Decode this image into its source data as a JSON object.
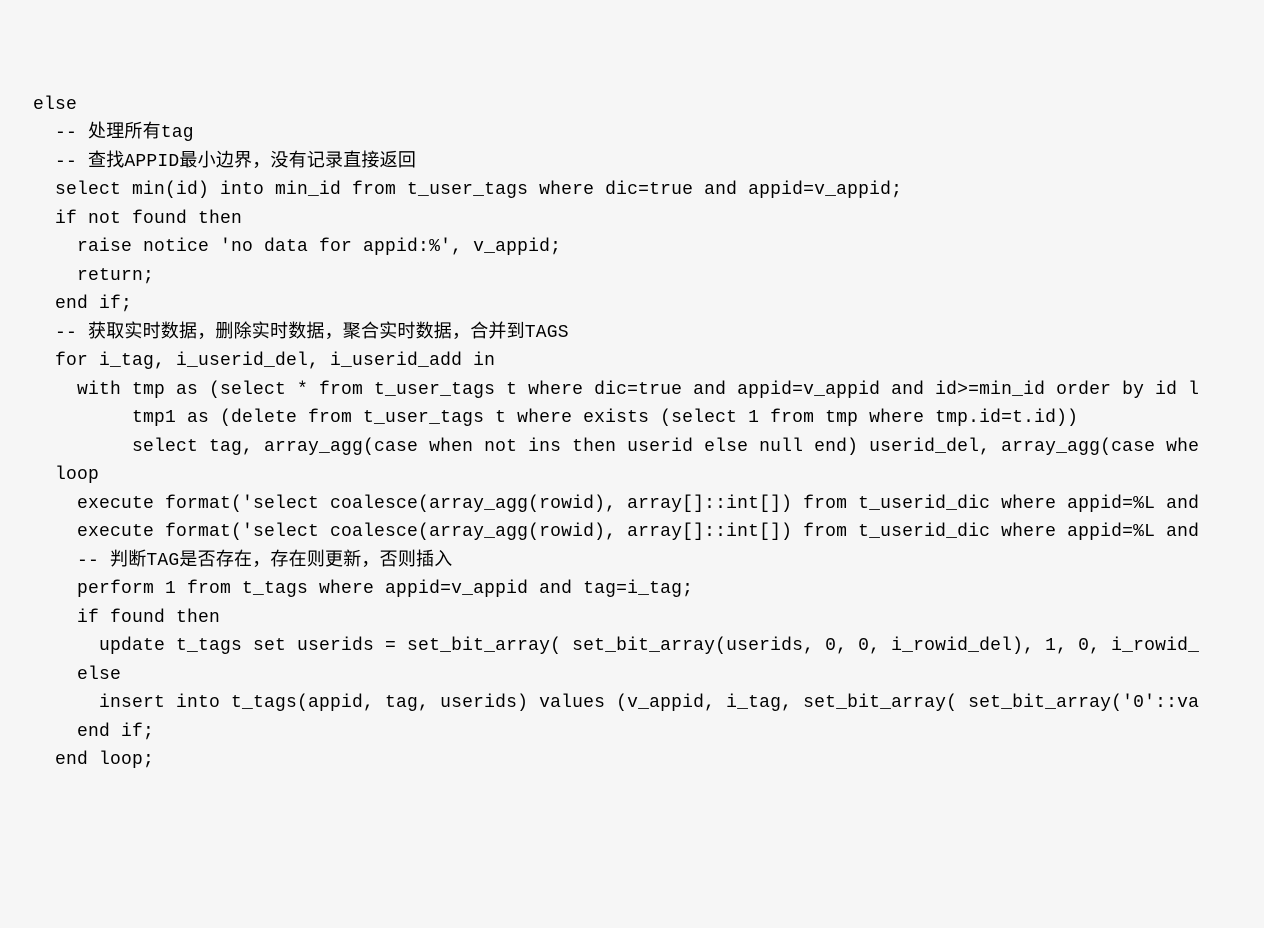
{
  "code": {
    "lines": [
      "else",
      "  -- 处理所有tag",
      "",
      "  -- 查找APPID最小边界，没有记录直接返回",
      "  select min(id) into min_id from t_user_tags where dic=true and appid=v_appid;",
      "  if not found then",
      "    raise notice 'no data for appid:%', v_appid;",
      "    return;",
      "  end if;",
      "",
      "  -- 获取实时数据，删除实时数据，聚合实时数据，合并到TAGS",
      "  for i_tag, i_userid_del, i_userid_add in",
      "    with tmp as (select * from t_user_tags t where dic=true and appid=v_appid and id>=min_id order by id l",
      "         tmp1 as (delete from t_user_tags t where exists (select 1 from tmp where tmp.id=t.id))",
      "         select tag, array_agg(case when not ins then userid else null end) userid_del, array_agg(case whe",
      "  loop",
      "    execute format('select coalesce(array_agg(rowid), array[]::int[]) from t_userid_dic where appid=%L and",
      "    execute format('select coalesce(array_agg(rowid), array[]::int[]) from t_userid_dic where appid=%L and",
      "",
      "    -- 判断TAG是否存在，存在则更新，否则插入",
      "    perform 1 from t_tags where appid=v_appid and tag=i_tag;",
      "    if found then",
      "      update t_tags set userids = set_bit_array( set_bit_array(userids, 0, 0, i_rowid_del), 1, 0, i_rowid_",
      "    else",
      "      insert into t_tags(appid, tag, userids) values (v_appid, i_tag, set_bit_array( set_bit_array('0'::va",
      "    end if;",
      "  end loop;"
    ]
  }
}
